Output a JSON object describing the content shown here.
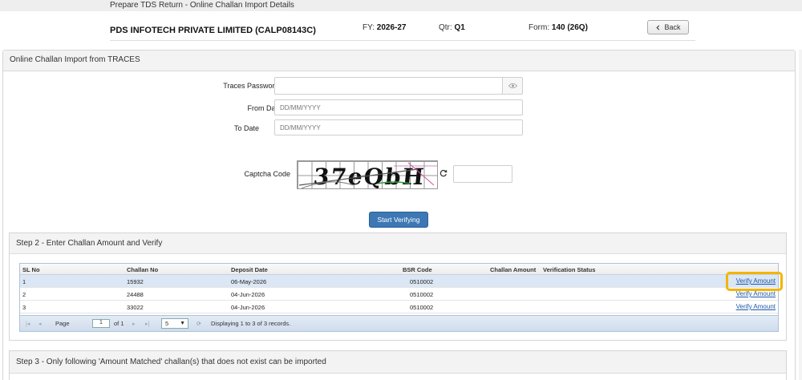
{
  "topbar": {
    "title": "Prepare TDS Return - Online Challan Import Details"
  },
  "header": {
    "company": "PDS INFOTECH PRIVATE LIMITED (CALP08143C)",
    "fy_label": "FY:",
    "fy_value": "2026-27",
    "qtr_label": "Qtr:",
    "qtr_value": "Q1",
    "form_label": "Form:",
    "form_value": "140 (26Q)",
    "back_label": "Back"
  },
  "panel": {
    "title": "Online Challan Import from TRACES"
  },
  "form": {
    "password_label": "Traces Password:",
    "from_label": "From Date",
    "from_placeholder": "DD/MM/YYYY",
    "to_label": "To Date",
    "to_placeholder": "DD/MM/YYYY",
    "captcha_label": "Captcha Code",
    "captcha_text": "37eQbH",
    "start_button": "Start Verifying"
  },
  "step2": {
    "title": "Step 2 - Enter Challan Amount and Verify",
    "columns": [
      "SL No",
      "Challan No",
      "Deposit Date",
      "BSR Code",
      "Challan Amount",
      "Verification Status"
    ],
    "rows": [
      {
        "sl": "1",
        "challan": "15932",
        "date": "06-May-2026",
        "bsr": "0510002",
        "amount": "",
        "status": "",
        "action": "Verify Amount"
      },
      {
        "sl": "2",
        "challan": "24488",
        "date": "04-Jun-2026",
        "bsr": "0510002",
        "amount": "",
        "status": "",
        "action": "Verify Amount"
      },
      {
        "sl": "3",
        "challan": "33022",
        "date": "04-Jun-2026",
        "bsr": "0510002",
        "amount": "",
        "status": "",
        "action": "Verify Amount"
      }
    ],
    "pager": {
      "page_label": "Page",
      "page_value": "1",
      "of_label": "of 1",
      "page_size": "5",
      "display_text": "Displaying 1 to 3 of 3 records."
    }
  },
  "step3": {
    "title": "Step 3 - Only following 'Amount Matched' challan(s) that does not exist can be imported"
  }
}
